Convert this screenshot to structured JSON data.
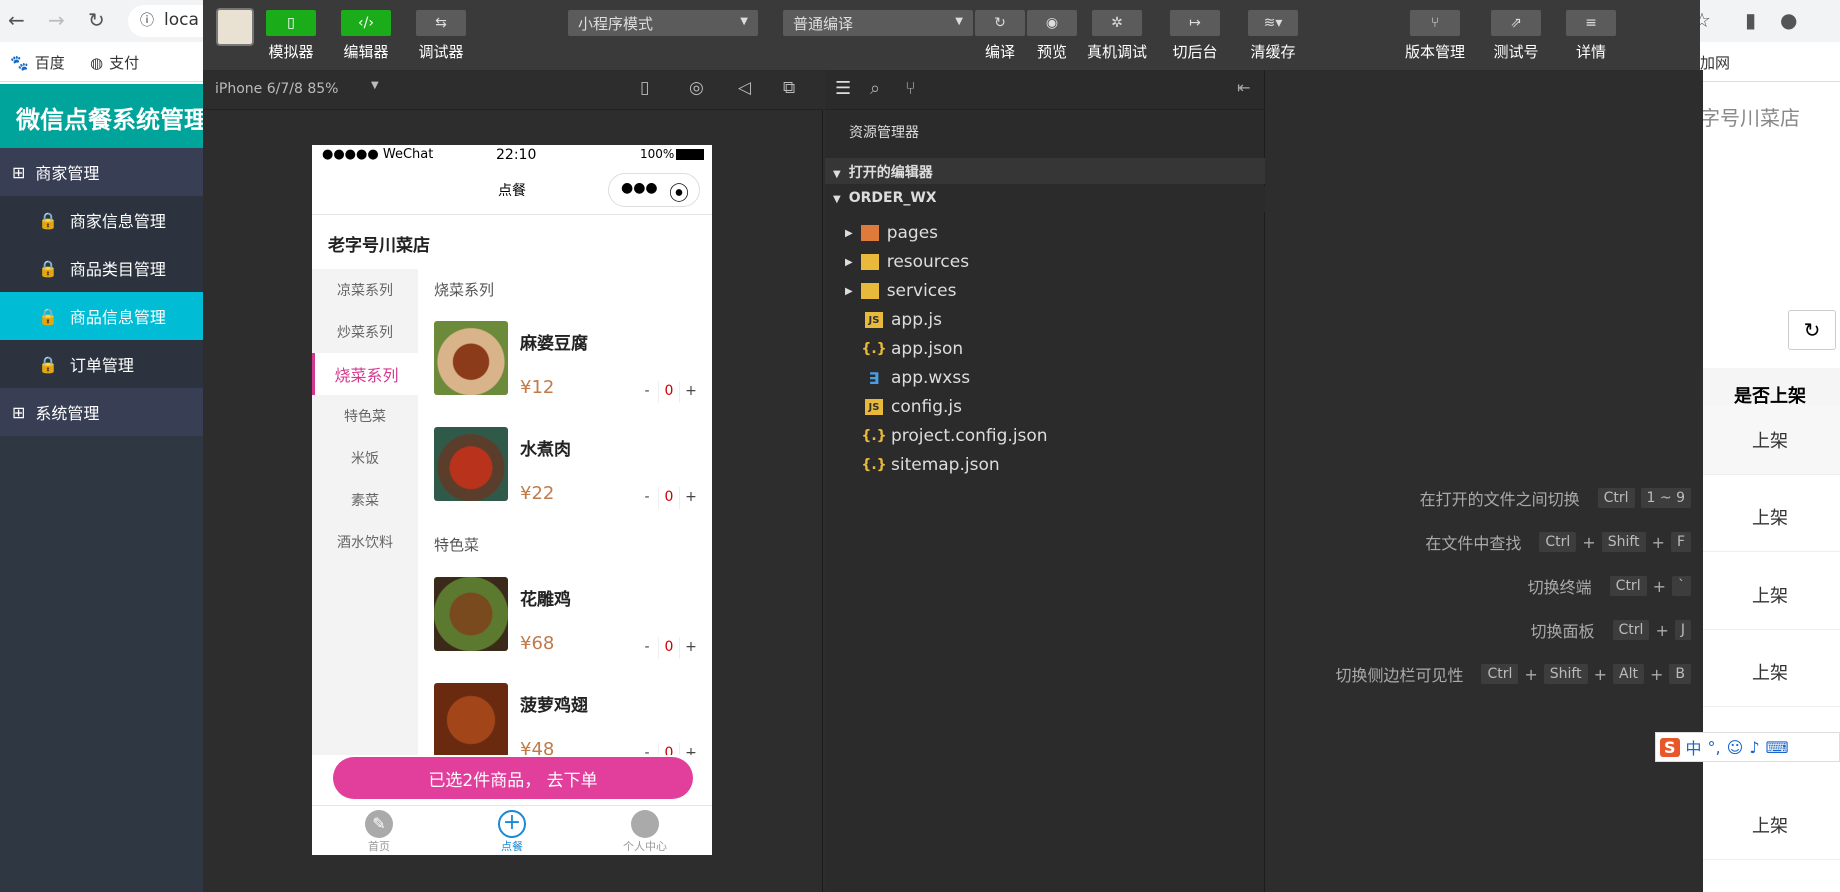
{
  "browser": {
    "url": "loca",
    "bookmarks": [
      "百度",
      "支付"
    ],
    "extra": "加网",
    "tab_right": "字号川菜店"
  },
  "admin": {
    "title": "微信点餐系统管理",
    "menu": [
      {
        "label": "商家管理",
        "type": "group"
      },
      {
        "label": "商家信息管理",
        "type": "item"
      },
      {
        "label": "商品类目管理",
        "type": "item"
      },
      {
        "label": "商品信息管理",
        "type": "item",
        "active": true
      },
      {
        "label": "订单管理",
        "type": "item"
      },
      {
        "label": "系统管理",
        "type": "group"
      }
    ],
    "right_header": "是否上架",
    "right_rows": [
      "上架",
      "上架",
      "上架",
      "上架",
      "上架"
    ]
  },
  "devtools": {
    "buttons": [
      {
        "label": "模拟器",
        "icon": "phone-icon"
      },
      {
        "label": "编辑器",
        "icon": "code-icon"
      },
      {
        "label": "调试器",
        "icon": "debug-icon"
      }
    ],
    "mode": "小程序模式",
    "compile_mode": "普通编译",
    "actions": [
      "编译",
      "预览",
      "真机调试",
      "切后台",
      "清缓存"
    ],
    "right_actions": [
      "版本管理",
      "测试号",
      "详情"
    ],
    "device": "iPhone 6/7/8 85%"
  },
  "phone": {
    "status": {
      "carrier": "●●●●● WeChat",
      "time": "22:10",
      "battery": "100%"
    },
    "nav_title": "点餐",
    "shop": "老字号川菜店",
    "categories": [
      "凉菜系列",
      "炒菜系列",
      "烧菜系列",
      "特色菜",
      "米饭",
      "素菜",
      "酒水饮料"
    ],
    "active_category": "烧菜系列",
    "sections": [
      "烧菜系列",
      "特色菜"
    ],
    "foods": [
      {
        "name": "麻婆豆腐",
        "price": "¥12",
        "qty": "0"
      },
      {
        "name": "水煮肉",
        "price": "¥22",
        "qty": "0"
      },
      {
        "name": "花雕鸡",
        "price": "¥68",
        "qty": "0"
      },
      {
        "name": "菠萝鸡翅",
        "price": "¥48",
        "qty": "0"
      }
    ],
    "order_btn": "已选2件商品， 去下单",
    "tabs": [
      "首页",
      "点餐",
      "个人中心"
    ]
  },
  "explorer": {
    "title": "资源管理器",
    "open_editors": "打开的编辑器",
    "project": "ORDER_WX",
    "files": [
      {
        "name": "pages",
        "type": "folder"
      },
      {
        "name": "resources",
        "type": "folder"
      },
      {
        "name": "services",
        "type": "folder"
      },
      {
        "name": "app.js",
        "type": "js"
      },
      {
        "name": "app.json",
        "type": "json"
      },
      {
        "name": "app.wxss",
        "type": "css"
      },
      {
        "name": "config.js",
        "type": "js"
      },
      {
        "name": "project.config.json",
        "type": "json"
      },
      {
        "name": "sitemap.json",
        "type": "json"
      }
    ]
  },
  "shortcuts": [
    {
      "label": "在打开的文件之间切换",
      "keys": [
        "Ctrl",
        "1 ~ 9"
      ]
    },
    {
      "label": "在文件中查找",
      "keys": [
        "Ctrl",
        "+",
        "Shift",
        "+",
        "F"
      ]
    },
    {
      "label": "切换终端",
      "keys": [
        "Ctrl",
        "+",
        "`"
      ]
    },
    {
      "label": "切换面板",
      "keys": [
        "Ctrl",
        "+",
        "J"
      ]
    },
    {
      "label": "切换侧边栏可见性",
      "keys": [
        "Ctrl",
        "+",
        "Shift",
        "+",
        "Alt",
        "+",
        "B"
      ]
    }
  ],
  "ime": {
    "text": "中"
  }
}
